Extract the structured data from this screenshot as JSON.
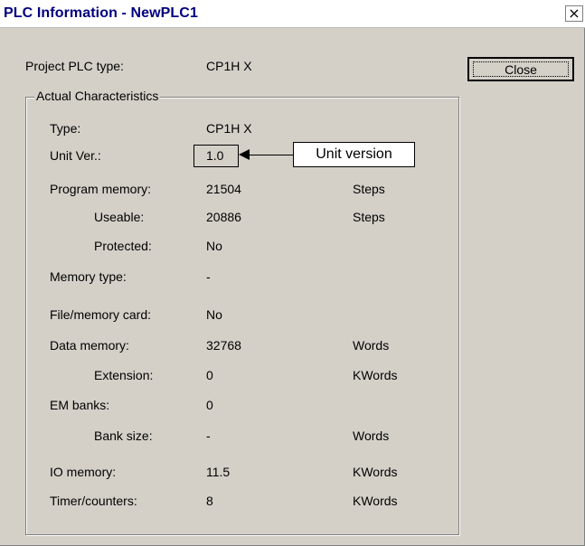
{
  "window": {
    "title": "PLC Information - NewPLC1",
    "close_glyph": "×"
  },
  "project": {
    "label": "Project PLC type:",
    "value": "CP1H X"
  },
  "close_button": {
    "label": "Close"
  },
  "group": {
    "legend": "Actual Characteristics"
  },
  "rows": [
    {
      "label": "Type:",
      "value": "CP1H X",
      "unit": ""
    },
    {
      "label": "Unit Ver.:",
      "value": "1.0",
      "unit": ""
    },
    {
      "label": "Program memory:",
      "value": "21504",
      "unit": "Steps"
    },
    {
      "label": "Useable:",
      "value": "20886",
      "unit": "Steps"
    },
    {
      "label": "Protected:",
      "value": "No",
      "unit": ""
    },
    {
      "label": "Memory type:",
      "value": "-",
      "unit": ""
    },
    {
      "label": "File/memory card:",
      "value": "No",
      "unit": ""
    },
    {
      "label": "Data memory:",
      "value": "32768",
      "unit": "Words"
    },
    {
      "label": "Extension:",
      "value": "0",
      "unit": "KWords"
    },
    {
      "label": "EM banks:",
      "value": "0",
      "unit": ""
    },
    {
      "label": "Bank size:",
      "value": "-",
      "unit": "Words"
    },
    {
      "label": "IO memory:",
      "value": "11.5",
      "unit": "KWords"
    },
    {
      "label": "Timer/counters:",
      "value": "8",
      "unit": "KWords"
    }
  ],
  "annotation": {
    "text": "Unit version"
  }
}
